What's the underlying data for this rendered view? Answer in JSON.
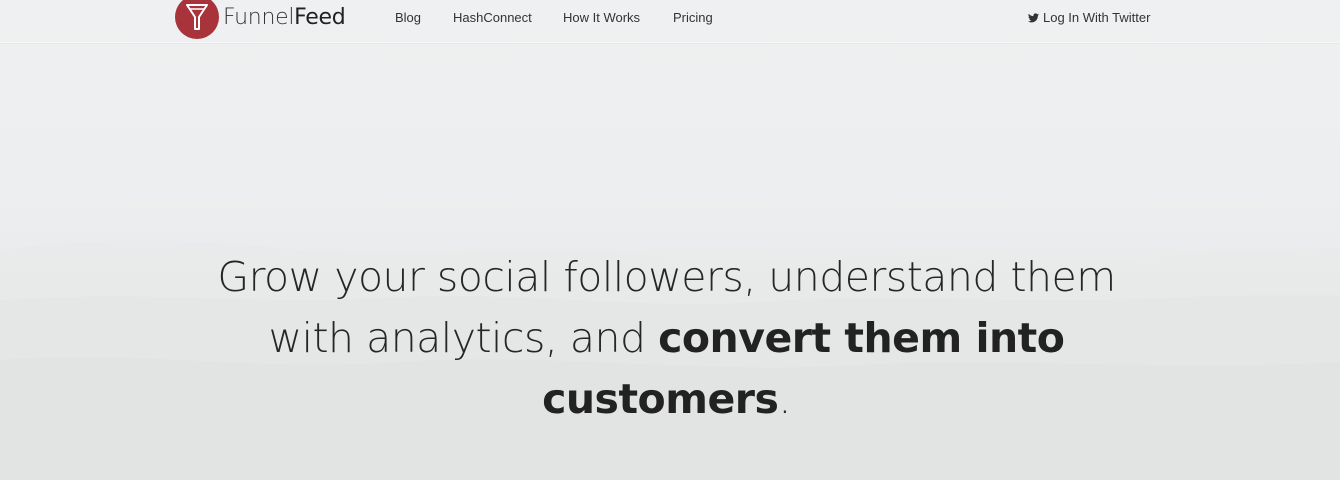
{
  "brand": {
    "name_light": "Funnel",
    "name_bold": "Feed",
    "accent_color": "#a8333a"
  },
  "nav": {
    "blog": "Blog",
    "hashconnect": "HashConnect",
    "how_it_works": "How It Works",
    "pricing": "Pricing",
    "login": "Log In With Twitter"
  },
  "hero": {
    "headline_light": "Grow your social followers, understand them with analytics, and ",
    "headline_bold_1": "convert them into",
    "headline_bold_2": "customers",
    "headline_end": "."
  },
  "icons": {
    "logo": "funnel-icon",
    "login": "twitter-icon"
  }
}
